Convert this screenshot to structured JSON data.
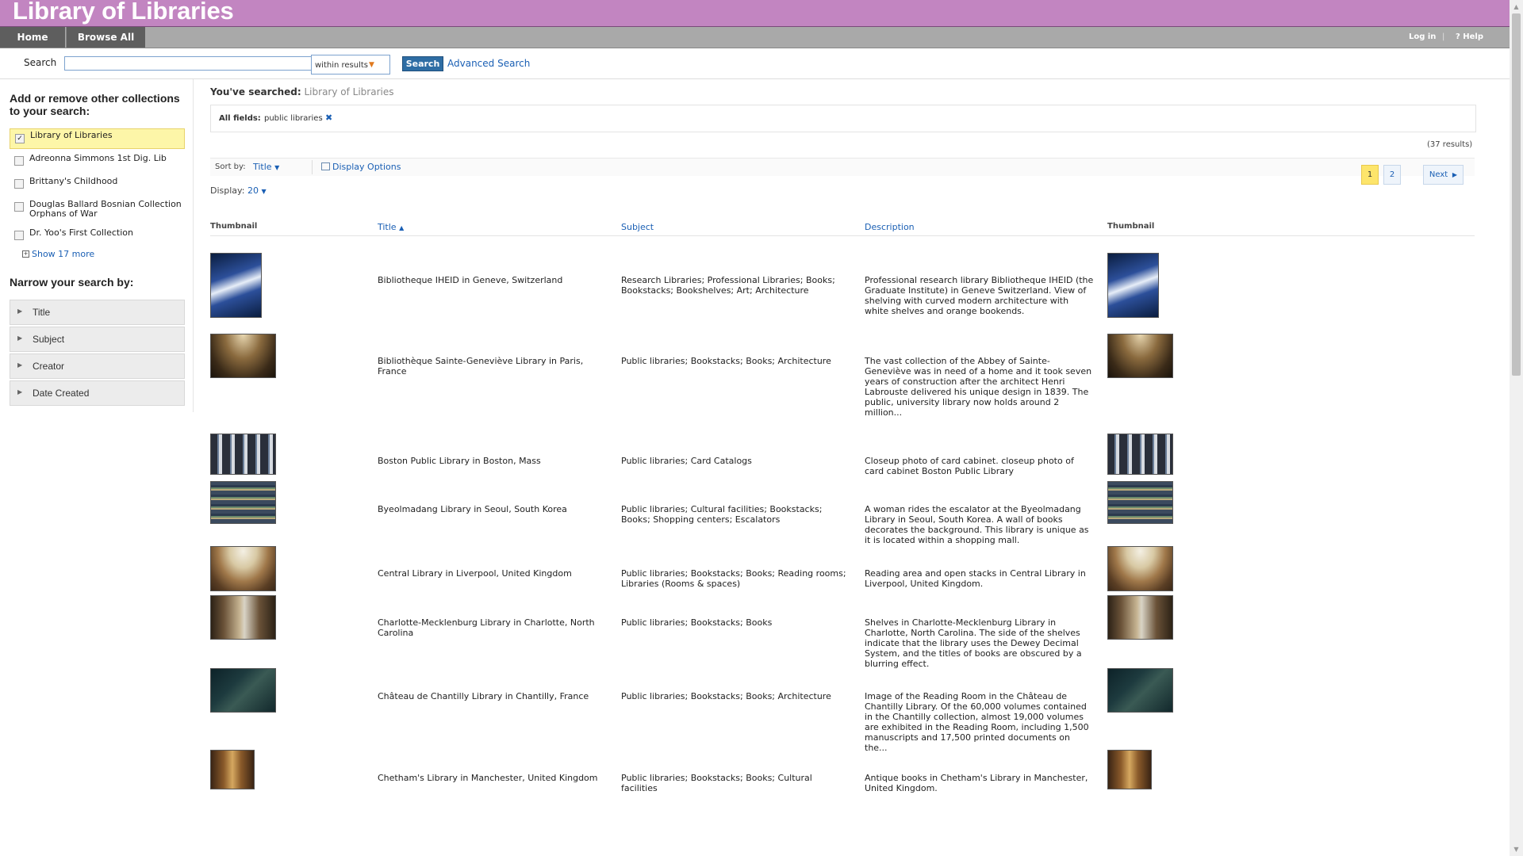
{
  "header": {
    "title": "Library of Libraries"
  },
  "nav": {
    "home": "Home",
    "browse": "Browse All",
    "login": "Log in",
    "separator": "|",
    "help": "? Help"
  },
  "search": {
    "label": "Search",
    "value": "",
    "within": "within results",
    "button": "Search",
    "advanced": "Advanced Search"
  },
  "sidebar": {
    "add_heading": "Add or remove other collections to your search:",
    "collections": [
      {
        "label": "Library of Libraries",
        "checked": true
      },
      {
        "label": "Adreonna Simmons 1st Dig. Lib",
        "checked": false
      },
      {
        "label": "Brittany's Childhood",
        "checked": false
      },
      {
        "label": "Douglas Ballard Bosnian Collection Orphans of War",
        "checked": false
      },
      {
        "label": "Dr. Yoo's First Collection",
        "checked": false
      }
    ],
    "show_more": "Show 17 more",
    "narrow_heading": "Narrow your search by:",
    "facets": [
      "Title",
      "Subject",
      "Creator",
      "Date Created"
    ]
  },
  "results": {
    "searched_label": "You've searched:",
    "searched_value": "Library of Libraries",
    "field_label": "All fields:",
    "field_value": "public libraries",
    "count": "(37 results)",
    "sort_label": "Sort by:",
    "sort_value": "Title",
    "display_options": "Display Options",
    "display_label": "Display:",
    "display_value": "20",
    "pages": [
      "1",
      "2"
    ],
    "next": "Next",
    "columns": {
      "thumb1": "Thumbnail",
      "title": "Title",
      "subject": "Subject",
      "description": "Description",
      "thumb2": "Thumbnail"
    },
    "rows": [
      {
        "title": "Bibliotheque IHEID in Geneve, Switzerland",
        "subject": "Research Libraries; Professional Libraries; Books; Bookstacks; Bookshelves; Art; Architecture",
        "description": "Professional research library Bibliotheque IHEID (the Graduate Institute) in Geneve Switzerland. View of shelving with curved modern architecture with white shelves and orange bookends."
      },
      {
        "title": "Bibliothèque Sainte-Geneviève Library in Paris, France",
        "subject": "Public libraries; Bookstacks; Books; Architecture",
        "description": "The vast collection of the Abbey of Sainte-Geneviève was in need of a home and it took seven years of construction after the architect Henri Labrouste delivered his unique design in 1839. The public, university library now holds around 2 million..."
      },
      {
        "title": "Boston Public Library in Boston, Mass",
        "subject": "Public libraries; Card Catalogs",
        "description": "Closeup photo of card cabinet. closeup photo of card cabinet Boston Public Library"
      },
      {
        "title": "Byeolmadang Library in Seoul, South Korea",
        "subject": "Public libraries; Cultural facilities; Bookstacks; Books; Shopping centers; Escalators",
        "description": "A woman rides the escalator at the Byeolmadang Library in Seoul, South Korea. A wall of books decorates the background. This library is unique as it is located within a shopping mall."
      },
      {
        "title": "Central Library in Liverpool, United Kingdom",
        "subject": "Public libraries; Bookstacks; Books; Reading rooms; Libraries (Rooms & spaces)",
        "description": "Reading area and open stacks in Central Library in Liverpool, United Kingdom."
      },
      {
        "title": "Charlotte-Mecklenburg Library in Charlotte, North Carolina",
        "subject": "Public libraries; Bookstacks; Books",
        "description": "Shelves in Charlotte-Mecklenburg Library in Charlotte, North Carolina. The side of the shelves indicate that the library uses the Dewey Decimal System, and the titles of books are obscured by a blurring effect."
      },
      {
        "title": "Château de Chantilly Library in Chantilly, France",
        "subject": "Public libraries; Bookstacks; Books; Architecture",
        "description": "Image of the Reading Room in the Château de Chantilly Library. Of the 60,000 volumes contained in the Chantilly collection, almost 19,000 volumes are exhibited in the Reading Room, including 1,500 manuscripts and 17,500 printed documents on the..."
      },
      {
        "title": "Chetham's Library in Manchester, United Kingdom",
        "subject": "Public libraries; Bookstacks; Books; Cultural facilities",
        "description": "Antique books in Chetham's Library in Manchester, United Kingdom."
      }
    ]
  },
  "colors": {
    "banner": "#c285c1",
    "nav": "#a9a9a9",
    "tab": "#5e5e5e",
    "link": "#1a5fb4",
    "highlight": "#fdf6a8"
  },
  "icons": {
    "checkbox": "checkbox-icon",
    "expand": "plus-box-icon",
    "facet": "triangle-right-icon",
    "sort_dropdown": "chevron-down-icon",
    "remove": "close-icon",
    "next": "chevron-right-icon",
    "display_options": "display-options-icon"
  }
}
